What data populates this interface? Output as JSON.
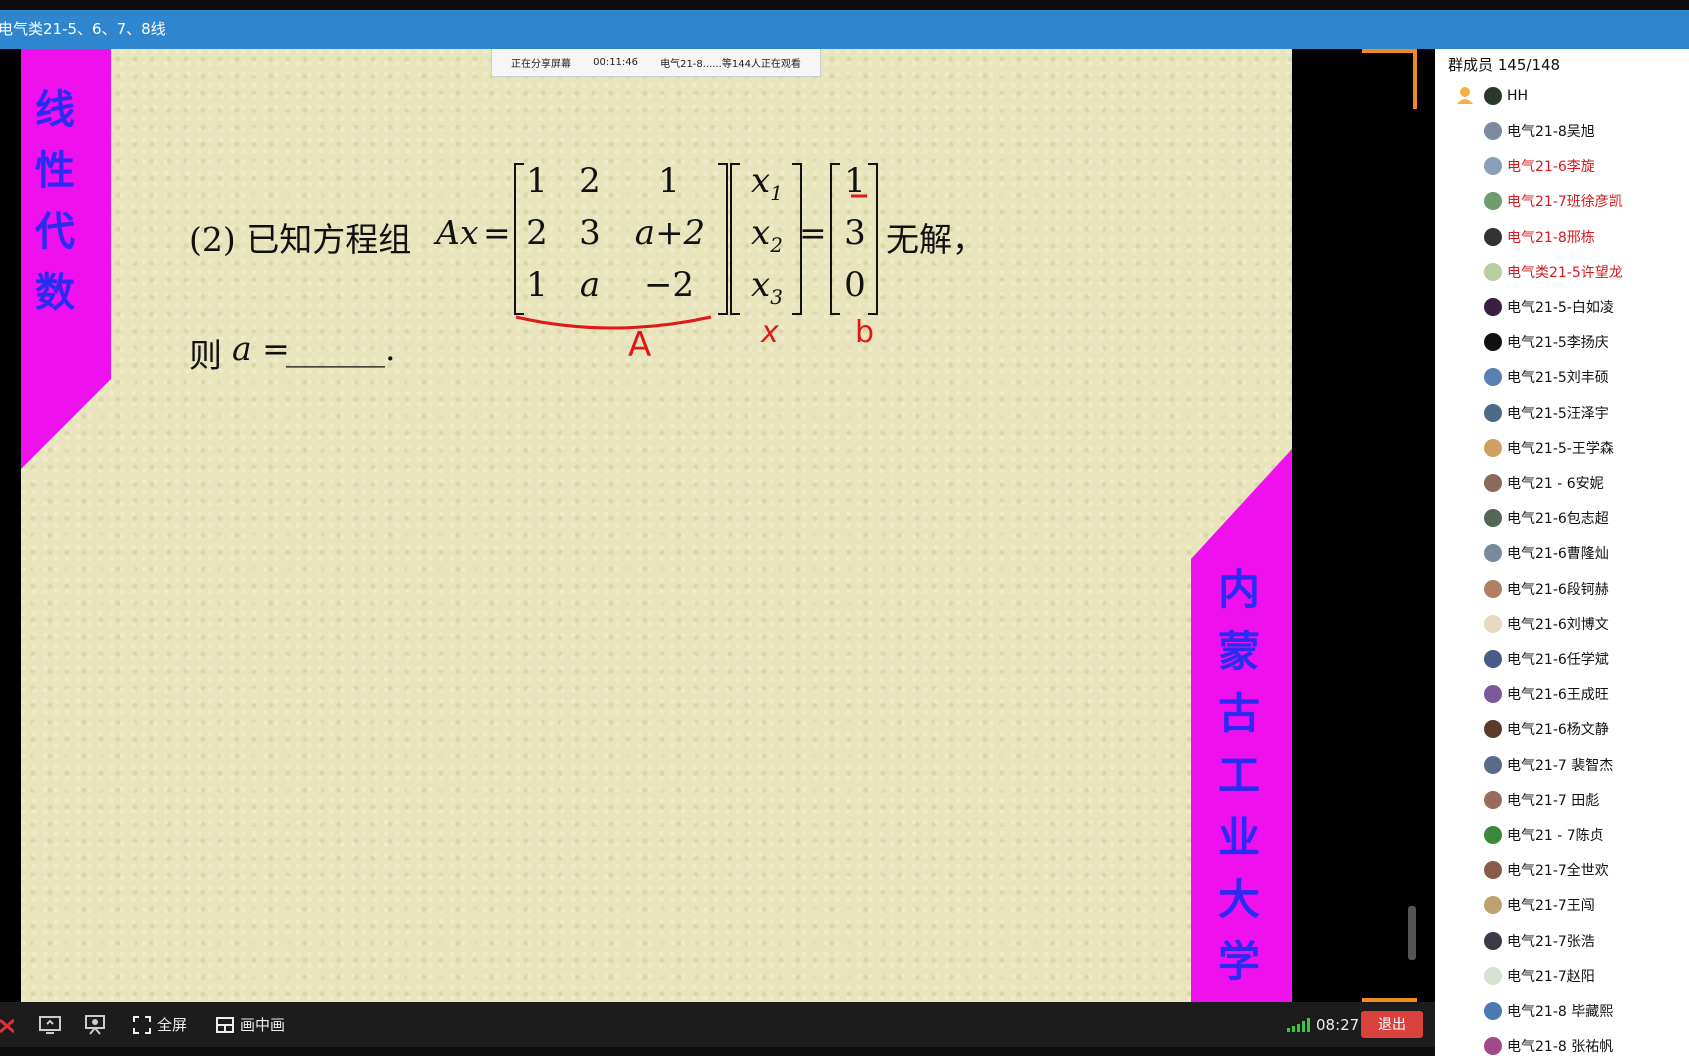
{
  "title": "电气类21-5、6、7、8线",
  "share_banner": {
    "status": "正在分享屏幕",
    "timer": "00:11:46",
    "viewers": "电气21-8......等144人正在观看"
  },
  "slide": {
    "course_vertical": [
      "线",
      "性",
      "代",
      "数"
    ],
    "university_vertical": [
      "内",
      "蒙",
      "古",
      "工",
      "业",
      "大",
      "学"
    ],
    "problem_prefix": "(2) 已知方程组",
    "problem_lhs": "Ax",
    "equals": "=",
    "no_solution": "无解，",
    "matrix_a": [
      [
        "1",
        "2",
        "1"
      ],
      [
        "2",
        "3",
        "a+2"
      ],
      [
        "1",
        "a",
        "−2"
      ]
    ],
    "vector_x": [
      "x",
      "x",
      "x"
    ],
    "vector_x_subs": [
      "1",
      "2",
      "3"
    ],
    "vector_b": [
      "1",
      "3",
      "0"
    ],
    "answer_prefix": "则",
    "answer_var": "a =",
    "answer_blank": "______.",
    "annotations": {
      "under_a": "A",
      "under_x": "x",
      "under_b": "b"
    }
  },
  "controls": {
    "fullscreen": "全屏",
    "pip": "画中画",
    "time": "08:27",
    "exit": "退出"
  },
  "members": {
    "header": "群成员 145/148",
    "owner": "HH",
    "list": [
      {
        "name": "电气21-8吴旭",
        "highlight": false,
        "color": "#7d8a9c"
      },
      {
        "name": "电气21-6李旋",
        "highlight": true,
        "color": "#8aa0b8"
      },
      {
        "name": "电气21-7班徐彦凯",
        "highlight": true,
        "color": "#6c9c70"
      },
      {
        "name": "电气21-8邢栋",
        "highlight": true,
        "color": "#333333"
      },
      {
        "name": "电气类21-5许望龙",
        "highlight": true,
        "color": "#b8d0a0"
      },
      {
        "name": "电气21-5-白如凌",
        "highlight": false,
        "color": "#3a2040"
      },
      {
        "name": "电气21-5李扬庆",
        "highlight": false,
        "color": "#111111"
      },
      {
        "name": "电气21-5刘丰硕",
        "highlight": false,
        "color": "#5a7fb0"
      },
      {
        "name": "电气21-5汪泽宇",
        "highlight": false,
        "color": "#4a6a88"
      },
      {
        "name": "电气21-5-王学森",
        "highlight": false,
        "color": "#d0a060"
      },
      {
        "name": "电气21 - 6安妮",
        "highlight": false,
        "color": "#8a6a5a"
      },
      {
        "name": "电气21-6包志超",
        "highlight": false,
        "color": "#556655"
      },
      {
        "name": "电气21-6曹隆灿",
        "highlight": false,
        "color": "#7a8a9a"
      },
      {
        "name": "电气21-6段钶赫",
        "highlight": false,
        "color": "#b08060"
      },
      {
        "name": "电气21-6刘博文",
        "highlight": false,
        "color": "#e8d8c0"
      },
      {
        "name": "电气21-6任学斌",
        "highlight": false,
        "color": "#4a5a8a"
      },
      {
        "name": "电气21-6王成旺",
        "highlight": false,
        "color": "#7a5a9a"
      },
      {
        "name": "电气21-6杨文静",
        "highlight": false,
        "color": "#5a3a2a"
      },
      {
        "name": "电气21-7 裴智杰",
        "highlight": false,
        "color": "#5a6a8a"
      },
      {
        "name": "电气21-7 田彪",
        "highlight": false,
        "color": "#9a6a5a"
      },
      {
        "name": "电气21 - 7陈贞",
        "highlight": false,
        "color": "#3a8a3a"
      },
      {
        "name": "电气21-7全世欢",
        "highlight": false,
        "color": "#8a5a4a"
      },
      {
        "name": "电气21-7王闯",
        "highlight": false,
        "color": "#c0a070"
      },
      {
        "name": "电气21-7张浩",
        "highlight": false,
        "color": "#3a3a4a"
      },
      {
        "name": "电气21-7赵阳",
        "highlight": false,
        "color": "#d8e0d0"
      },
      {
        "name": "电气21-8 毕藏熙",
        "highlight": false,
        "color": "#4a7ab0"
      },
      {
        "name": "电气21-8 张祐帆",
        "highlight": false,
        "color": "#a04a8a"
      }
    ]
  },
  "colors": {
    "title_bar": "#2f86cf",
    "slide_bg": "#e8e4bb",
    "magenta_band": "#ee11ee",
    "vertical_text": "#2a2af0",
    "annotation_red": "#e01818",
    "exit_button": "#d9413c",
    "member_highlight": "#d8181e",
    "orange_tab": "#f08a1e"
  }
}
